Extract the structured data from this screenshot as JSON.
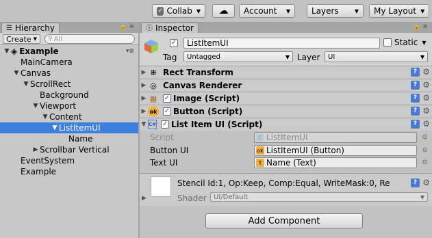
{
  "toolbar": {
    "collab": "Collab",
    "account": "Account",
    "layers": "Layers",
    "layout": "My Layout"
  },
  "hierarchy": {
    "tab": "Hierarchy",
    "create": "Create",
    "search_placeholder": "All",
    "scene": "Example",
    "items": [
      {
        "label": "MainCamera",
        "depth": 1,
        "arrow": ""
      },
      {
        "label": "Canvas",
        "depth": 1,
        "arrow": "▼"
      },
      {
        "label": "ScrollRect",
        "depth": 2,
        "arrow": "▼"
      },
      {
        "label": "Background",
        "depth": 3,
        "arrow": ""
      },
      {
        "label": "Viewport",
        "depth": 3,
        "arrow": "▼"
      },
      {
        "label": "Content",
        "depth": 4,
        "arrow": "▼"
      },
      {
        "label": "ListItemUI",
        "depth": 5,
        "arrow": "▼",
        "selected": true
      },
      {
        "label": "Name",
        "depth": 6,
        "arrow": ""
      },
      {
        "label": "Scrollbar Vertical",
        "depth": 3,
        "arrow": "▶"
      },
      {
        "label": "EventSystem",
        "depth": 1,
        "arrow": ""
      },
      {
        "label": "Example",
        "depth": 1,
        "arrow": ""
      }
    ]
  },
  "inspector": {
    "tab": "Inspector",
    "object_name": "ListItemUI",
    "static_label": "Static",
    "tag_label": "Tag",
    "tag_value": "Untagged",
    "layer_label": "Layer",
    "layer_value": "UI",
    "components": [
      {
        "name": "Rect Transform",
        "icon": "rect-transform-icon",
        "checkbox": false
      },
      {
        "name": "Canvas Renderer",
        "icon": "canvas-renderer-icon",
        "checkbox": false
      },
      {
        "name": "Image (Script)",
        "icon": "image-script-icon",
        "checkbox": true
      },
      {
        "name": "Button (Script)",
        "icon": "button-script-icon",
        "checkbox": true
      },
      {
        "name": "List Item UI (Script)",
        "icon": "cs-script-icon",
        "checkbox": true
      }
    ],
    "script_props": [
      {
        "label": "Script",
        "value": "ListItemUI",
        "disabled": true
      },
      {
        "label": "Button UI",
        "value": "ListItemUI (Button)",
        "disabled": false
      },
      {
        "label": "Text UI",
        "value": "Name (Text)",
        "disabled": false
      }
    ],
    "material_text": "Stencil Id:1, Op:Keep, Comp:Equal, WriteMask:0, Re",
    "shader_label": "Shader",
    "shader_value": "UI/Default",
    "add_component": "Add Component"
  }
}
